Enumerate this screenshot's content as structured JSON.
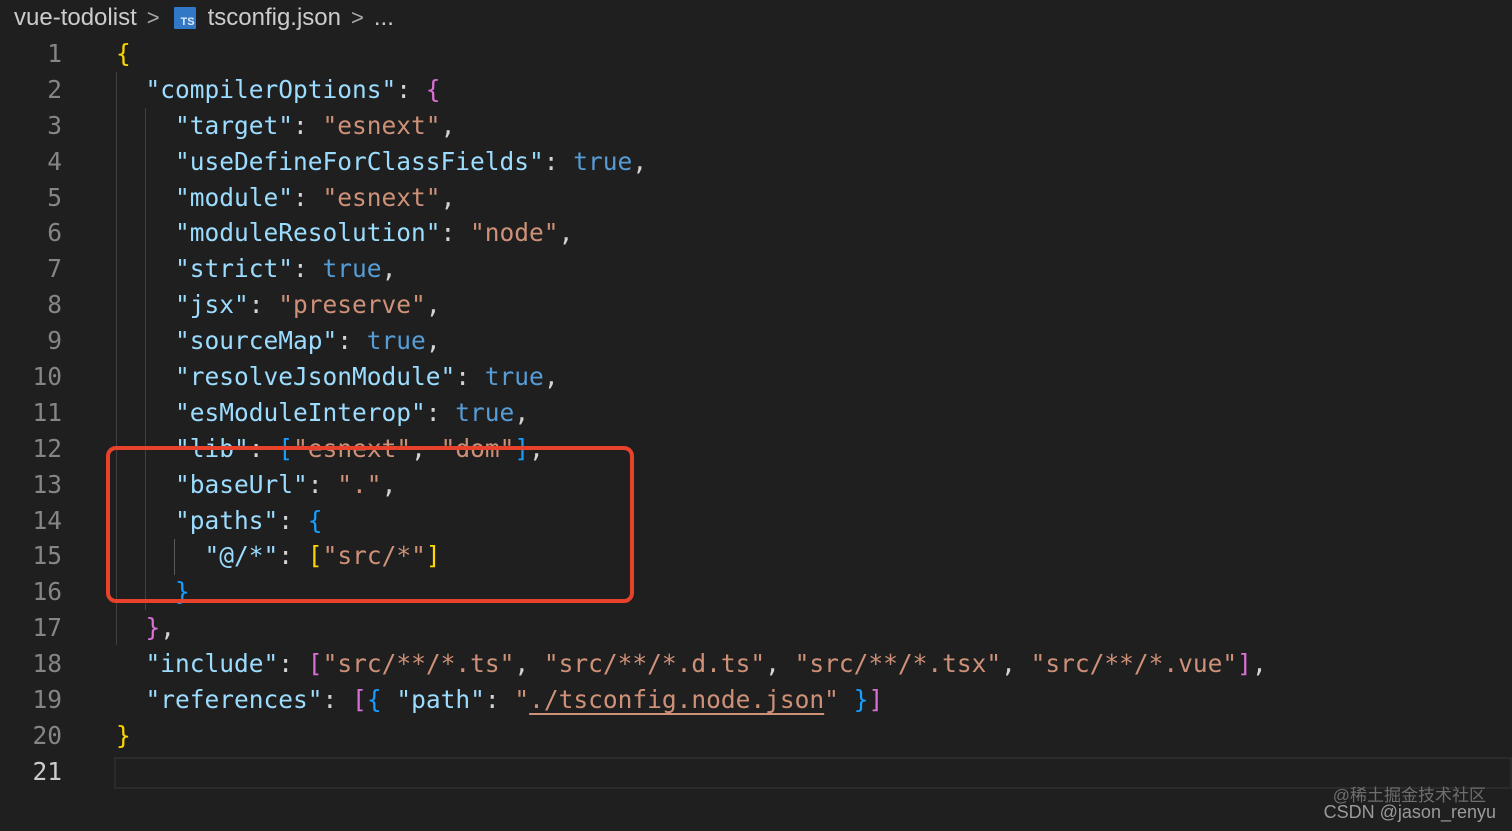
{
  "breadcrumb": {
    "folder": "vue-todolist",
    "file_icon": "typescript-file-icon",
    "file_icon_text": "TS",
    "file": "tsconfig.json",
    "more": "..."
  },
  "editor": {
    "active_line": 21,
    "line_numbers": [
      "1",
      "2",
      "3",
      "4",
      "5",
      "6",
      "7",
      "8",
      "9",
      "10",
      "11",
      "12",
      "13",
      "14",
      "15",
      "16",
      "17",
      "18",
      "19",
      "20",
      "21"
    ],
    "lines": [
      "{",
      "  \"compilerOptions\": {",
      "    \"target\": \"esnext\",",
      "    \"useDefineForClassFields\": true,",
      "    \"module\": \"esnext\",",
      "    \"moduleResolution\": \"node\",",
      "    \"strict\": true,",
      "    \"jsx\": \"preserve\",",
      "    \"sourceMap\": true,",
      "    \"resolveJsonModule\": true,",
      "    \"esModuleInterop\": true,",
      "    \"lib\": [\"esnext\", \"dom\"],",
      "    \"baseUrl\": \".\",",
      "    \"paths\": {",
      "      \"@/*\": [\"src/*\"]",
      "    }",
      "  },",
      "  \"include\": [\"src/**/*.ts\", \"src/**/*.d.ts\", \"src/**/*.tsx\", \"src/**/*.vue\"],",
      "  \"references\": [{ \"path\": \"./tsconfig.node.json\" }]",
      "}",
      ""
    ]
  },
  "colors": {
    "background": "#1f1f1f",
    "key": "#9cdcfe",
    "string": "#ce9178",
    "boolean": "#569cd6",
    "bracket_level1": "#ffd700",
    "bracket_level2": "#da70d6",
    "bracket_level3": "#179fff",
    "annotation_box": "#e8412c"
  },
  "watermark": {
    "line1": "@稀土掘金技术社区",
    "line2": "CSDN @jason_renyu"
  }
}
